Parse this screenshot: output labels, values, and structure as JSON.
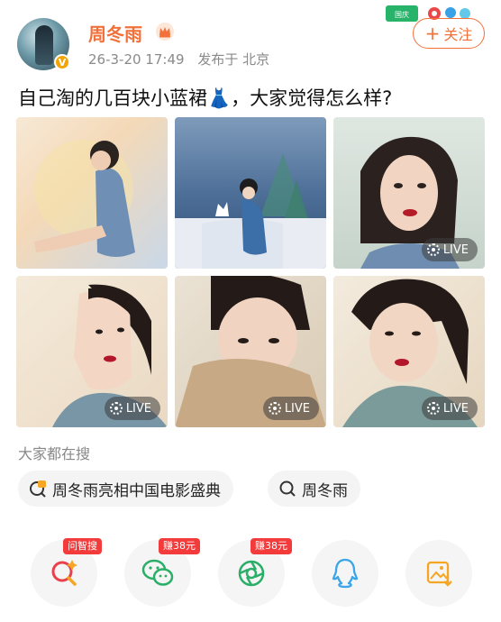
{
  "author": {
    "name": "周冬雨",
    "time": "26-3-20 17:49",
    "location": "发布于 北京"
  },
  "promo_badge": "国庆抽奖追星高手",
  "follow_label": "关注",
  "post": {
    "text": "自己淘的几百块小蓝裙👗，大家觉得怎么样?"
  },
  "photos": [
    {
      "live": ""
    },
    {
      "live": ""
    },
    {
      "live": "LIVE"
    },
    {
      "live": "LIVE"
    },
    {
      "live": "LIVE"
    },
    {
      "live": "LIVE"
    }
  ],
  "search": {
    "heading": "大家都在搜",
    "chips": [
      {
        "label": "周冬雨亮相中国电影盛典",
        "icon": "hot-search-icon"
      },
      {
        "label": "周冬雨",
        "icon": "search-icon"
      }
    ]
  },
  "share": [
    {
      "icon": "ask-ai-icon",
      "badge": "问智搜"
    },
    {
      "icon": "wechat-icon",
      "badge": "赚38元"
    },
    {
      "icon": "moments-icon",
      "badge": "赚38元"
    },
    {
      "icon": "qq-icon",
      "badge": ""
    },
    {
      "icon": "save-image-icon",
      "badge": ""
    }
  ],
  "colors": {
    "accent": "#f2713a",
    "badge_red": "#f43b3b",
    "verified": "#f4a400"
  }
}
